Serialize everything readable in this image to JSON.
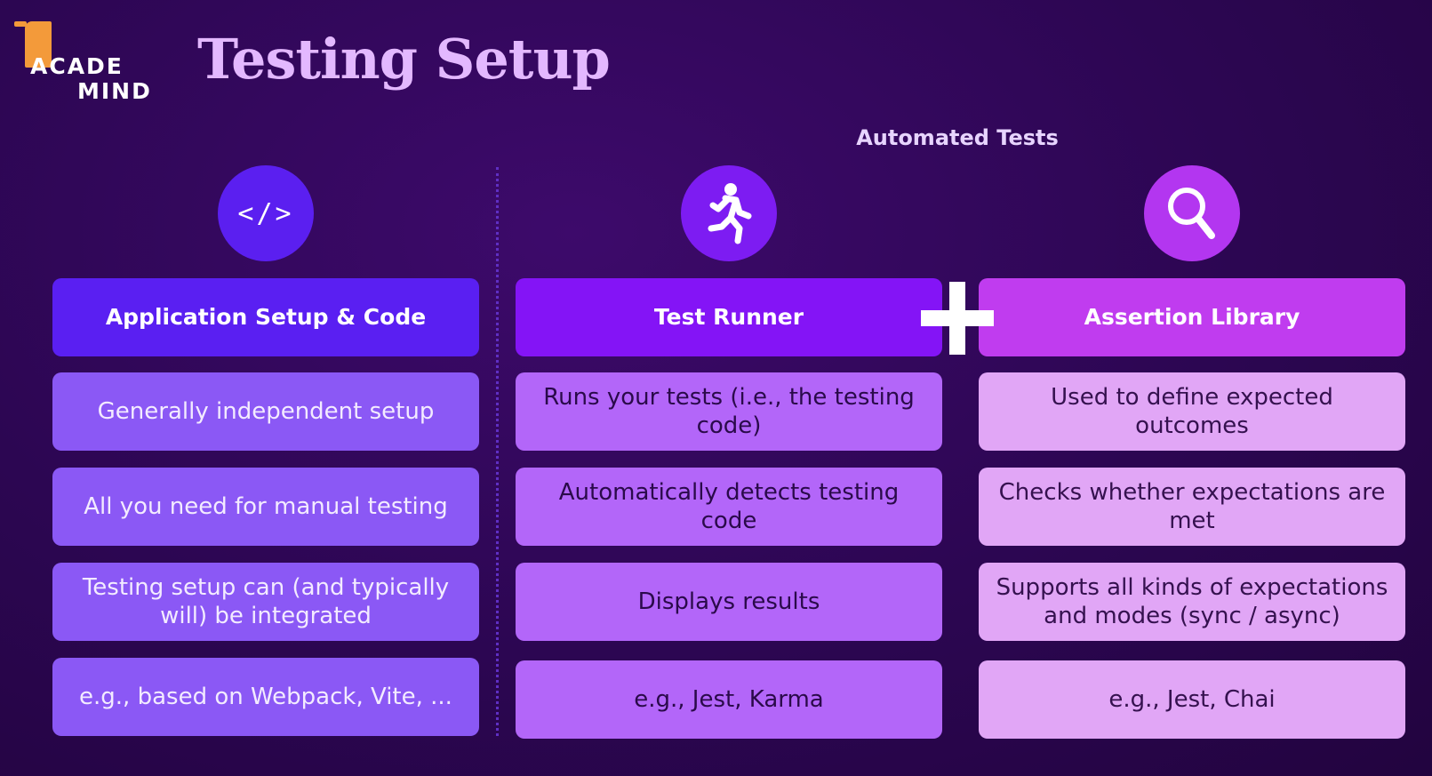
{
  "logo": {
    "line1": "ACADE",
    "line2": "MIND",
    "accent": "#f39a3a"
  },
  "title": "Testing Setup",
  "group_label": "Automated Tests",
  "columns": [
    {
      "icon": "code-icon",
      "icon_text": "</>",
      "header": "Application Setup & Code",
      "items": [
        "Generally independent setup",
        "All you need for manual testing",
        "Testing setup can (and typically will) be integrated",
        "e.g., based on Webpack, Vite, ..."
      ]
    },
    {
      "icon": "running-person-icon",
      "header": "Test Runner",
      "items": [
        "Runs your tests (i.e., the testing code)",
        "Automatically detects testing code",
        "Displays results",
        "e.g., Jest, Karma"
      ]
    },
    {
      "icon": "magnifier-icon",
      "header": "Assertion Library",
      "items": [
        "Used to define expected outcomes",
        "Checks whether expectations are met",
        "Supports all kinds of expectations and modes (sync / async)",
        "e.g., Jest, Chai"
      ]
    }
  ],
  "colors": {
    "background": "#2c0652",
    "title": "#e3b8ff",
    "col1_header": "#5a1ff2",
    "col2_header": "#8414f6",
    "col3_header": "#c03cef"
  }
}
